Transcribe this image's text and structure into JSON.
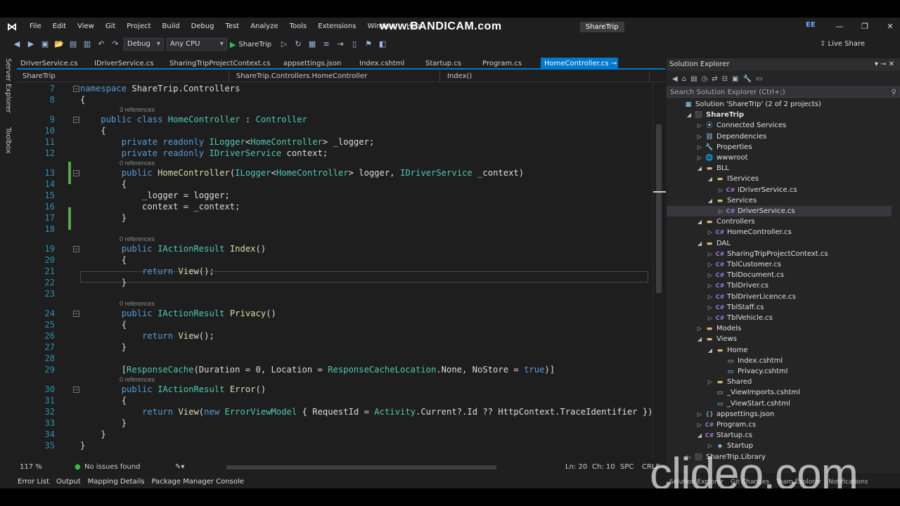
{
  "menubar": {
    "items": [
      "File",
      "Edit",
      "View",
      "Git",
      "Project",
      "Build",
      "Debug",
      "Test",
      "Analyze",
      "Tools",
      "Extensions",
      "Window",
      "Help"
    ],
    "solution_name": "ShareTrip",
    "account": "EE",
    "watermark": "www.BANDICAM.com"
  },
  "toolbar": {
    "config": "Debug",
    "platform": "Any CPU",
    "run_target": "ShareTrip",
    "live_share": "Live Share"
  },
  "side_tabs": [
    "Server Explorer",
    "Toolbox"
  ],
  "tabs": [
    "DriverService.cs",
    "IDriverService.cs",
    "SharingTripProjectContext.cs",
    "appsettings.json",
    "Index.cshtml",
    "Startup.cs",
    "Program.cs",
    "HomeController.cs"
  ],
  "navbar": {
    "project": "ShareTrip",
    "class": "ShareTrip.Controllers.HomeController",
    "member": "Index()"
  },
  "codelens": {
    "refs3": "3 references",
    "refs0": "0 references"
  },
  "lines": [
    {
      "n": "7"
    },
    {
      "n": "8"
    },
    {
      "n": "9"
    },
    {
      "n": "10"
    },
    {
      "n": "11"
    },
    {
      "n": "12"
    },
    {
      "n": "13"
    },
    {
      "n": "14"
    },
    {
      "n": "15"
    },
    {
      "n": "16"
    },
    {
      "n": "17"
    },
    {
      "n": "18"
    },
    {
      "n": "19"
    },
    {
      "n": "20"
    },
    {
      "n": "21"
    },
    {
      "n": "22"
    },
    {
      "n": "23"
    },
    {
      "n": "24"
    },
    {
      "n": "25"
    },
    {
      "n": "26"
    },
    {
      "n": "27"
    },
    {
      "n": "28"
    },
    {
      "n": "29"
    },
    {
      "n": "30"
    },
    {
      "n": "31"
    },
    {
      "n": "32"
    },
    {
      "n": "33"
    },
    {
      "n": "34"
    },
    {
      "n": "35"
    }
  ],
  "status": {
    "zoom": "117 %",
    "issues": "No issues found",
    "ln": "Ln: 20",
    "ch": "Ch: 10",
    "spc": "SPC",
    "crlf": "CRLF"
  },
  "bottom_tabs": [
    "Error List",
    "Output",
    "Mapping Details",
    "Package Manager Console"
  ],
  "solution_explorer": {
    "title": "Solution Explorer",
    "search_placeholder": "Search Solution Explorer (Ctrl+;)",
    "tree": [
      {
        "label": "Solution 'ShareTrip' (2 of 2 projects)",
        "depth": 0,
        "icon": "solution",
        "exp": ""
      },
      {
        "label": "ShareTrip",
        "depth": 1,
        "icon": "project",
        "exp": "open",
        "bold": true
      },
      {
        "label": "Connected Services",
        "depth": 2,
        "icon": "connected",
        "exp": "closed"
      },
      {
        "label": "Dependencies",
        "depth": 2,
        "icon": "deps",
        "exp": "closed"
      },
      {
        "label": "Properties",
        "depth": 2,
        "icon": "props",
        "exp": "closed"
      },
      {
        "label": "wwwroot",
        "depth": 2,
        "icon": "globe",
        "exp": "closed"
      },
      {
        "label": "BLL",
        "depth": 2,
        "icon": "folder",
        "exp": "open"
      },
      {
        "label": "IServices",
        "depth": 3,
        "icon": "folder",
        "exp": "open"
      },
      {
        "label": "IDriverService.cs",
        "depth": 4,
        "icon": "cs",
        "exp": "closed"
      },
      {
        "label": "Services",
        "depth": 3,
        "icon": "folder",
        "exp": "open"
      },
      {
        "label": "DriverService.cs",
        "depth": 4,
        "icon": "cs",
        "exp": "closed",
        "selected": true
      },
      {
        "label": "Controllers",
        "depth": 2,
        "icon": "folder",
        "exp": "open"
      },
      {
        "label": "HomeController.cs",
        "depth": 3,
        "icon": "cs",
        "exp": "closed"
      },
      {
        "label": "DAL",
        "depth": 2,
        "icon": "folder",
        "exp": "open"
      },
      {
        "label": "SharingTripProjectContext.cs",
        "depth": 3,
        "icon": "cs",
        "exp": "closed"
      },
      {
        "label": "TblCustomer.cs",
        "depth": 3,
        "icon": "cs",
        "exp": "closed"
      },
      {
        "label": "TblDocument.cs",
        "depth": 3,
        "icon": "cs",
        "exp": "closed"
      },
      {
        "label": "TblDriver.cs",
        "depth": 3,
        "icon": "cs",
        "exp": "closed"
      },
      {
        "label": "TblDriverLicence.cs",
        "depth": 3,
        "icon": "cs",
        "exp": "closed"
      },
      {
        "label": "TblStaff.cs",
        "depth": 3,
        "icon": "cs",
        "exp": "closed"
      },
      {
        "label": "TblVehicle.cs",
        "depth": 3,
        "icon": "cs",
        "exp": "closed"
      },
      {
        "label": "Models",
        "depth": 2,
        "icon": "folder",
        "exp": "closed"
      },
      {
        "label": "Views",
        "depth": 2,
        "icon": "folder",
        "exp": "open"
      },
      {
        "label": "Home",
        "depth": 3,
        "icon": "folder",
        "exp": "open"
      },
      {
        "label": "Index.cshtml",
        "depth": 4,
        "icon": "file",
        "exp": ""
      },
      {
        "label": "Privacy.cshtml",
        "depth": 4,
        "icon": "file",
        "exp": ""
      },
      {
        "label": "Shared",
        "depth": 3,
        "icon": "folder",
        "exp": "closed"
      },
      {
        "label": "_ViewImports.cshtml",
        "depth": 3,
        "icon": "file",
        "exp": ""
      },
      {
        "label": "_ViewStart.cshtml",
        "depth": 3,
        "icon": "file",
        "exp": ""
      },
      {
        "label": "appsettings.json",
        "depth": 2,
        "icon": "json",
        "exp": "closed"
      },
      {
        "label": "Program.cs",
        "depth": 2,
        "icon": "cs",
        "exp": "closed"
      },
      {
        "label": "Startup.cs",
        "depth": 2,
        "icon": "cs",
        "exp": "open"
      },
      {
        "label": "Startup",
        "depth": 3,
        "icon": "class",
        "exp": "closed"
      },
      {
        "label": "ShareTrip.Library",
        "depth": 1,
        "icon": "project",
        "exp": "closed"
      }
    ],
    "bottom_tabs": [
      "Solution Explorer",
      "Git Changes",
      "Team Explorer",
      "Notifications"
    ]
  },
  "overlay_watermark": "clideo.com"
}
